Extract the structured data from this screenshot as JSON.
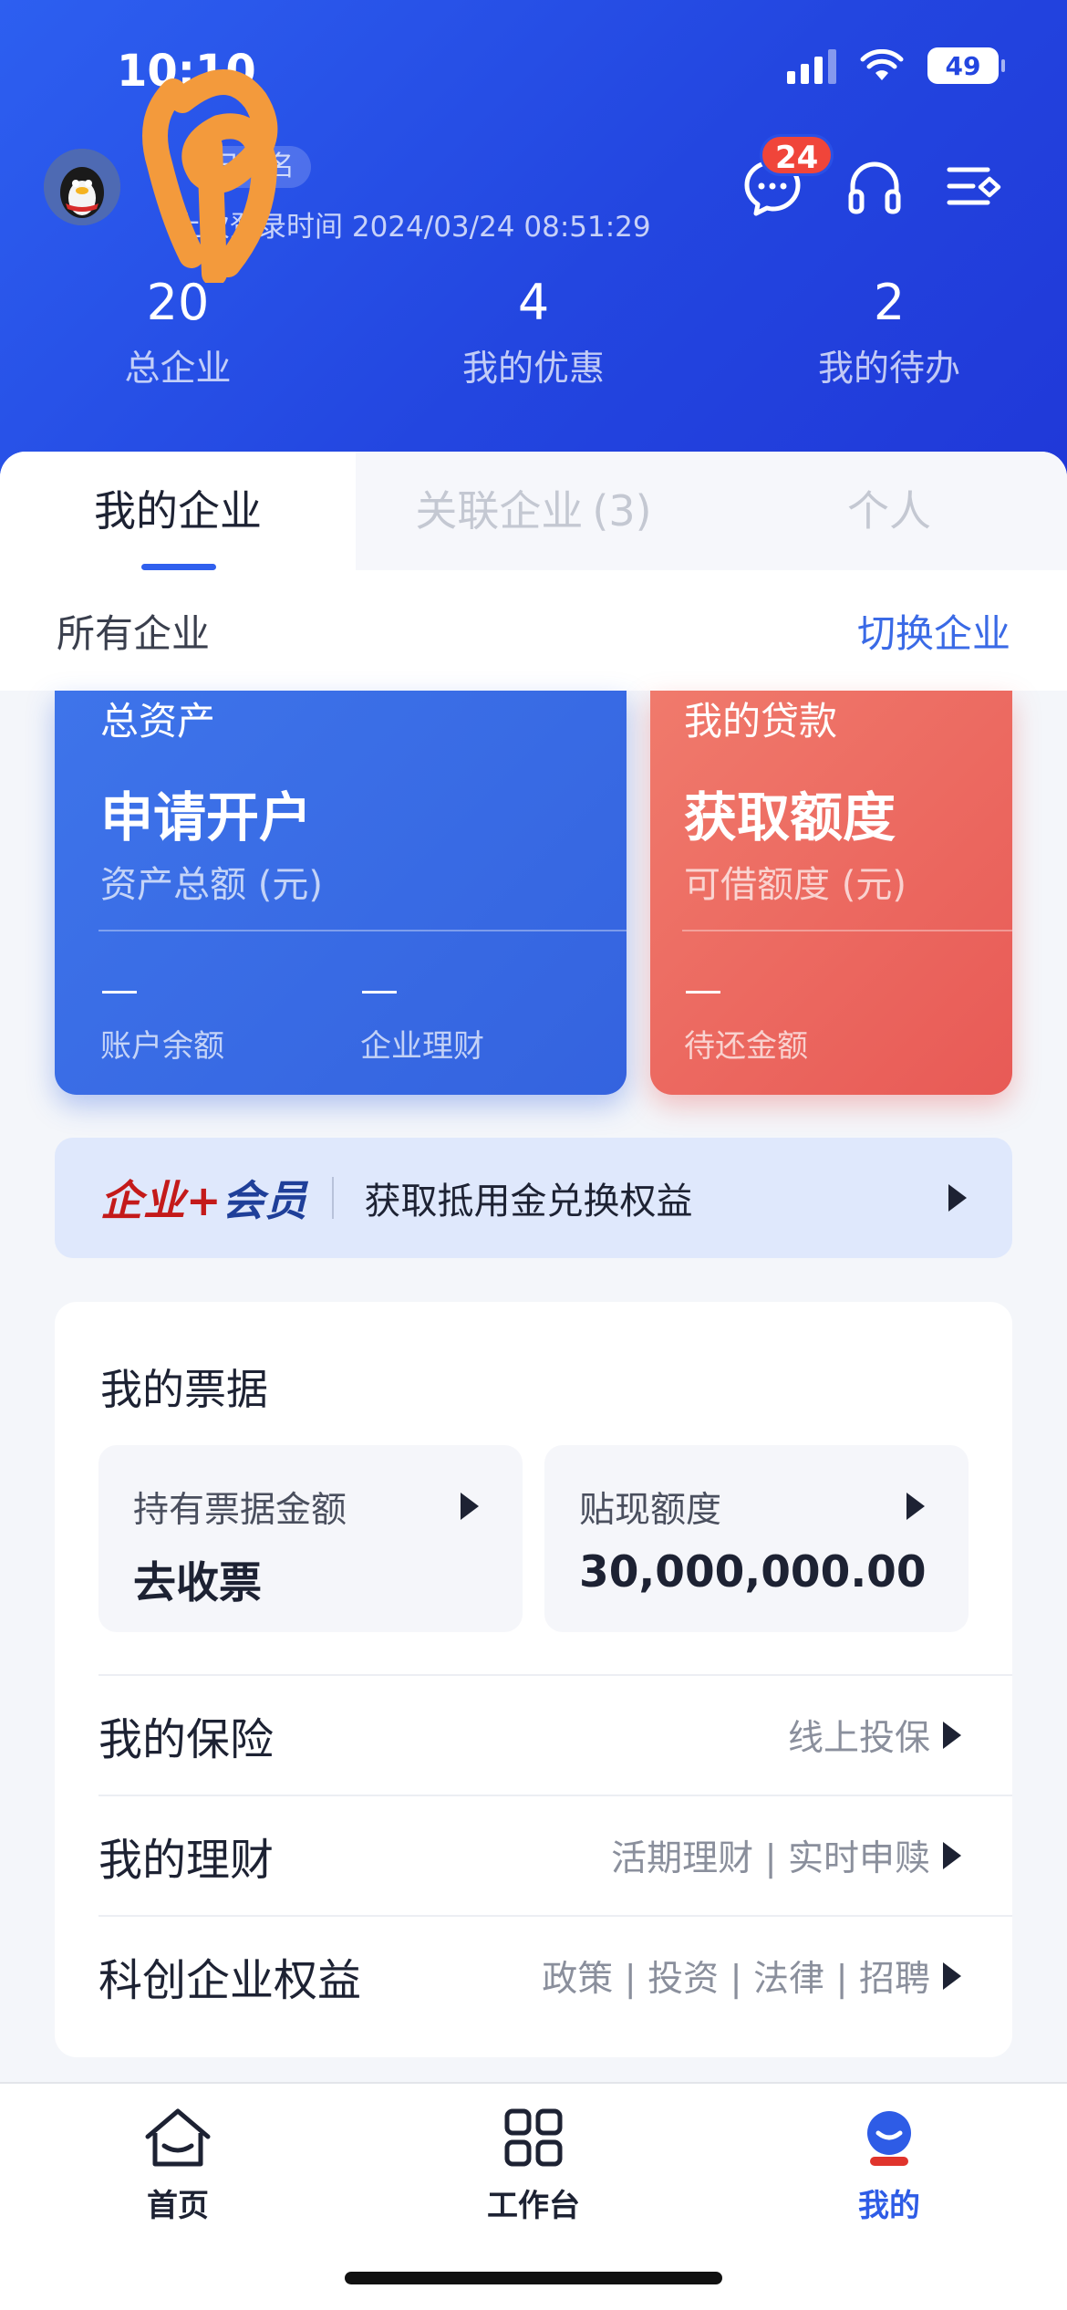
{
  "status_bar": {
    "time": "10:10",
    "battery": "49"
  },
  "header": {
    "verified_label": "已实名",
    "last_login": "上次登录时间 2024/03/24 08:51:29",
    "message_badge": "24",
    "stats": [
      {
        "value": "20",
        "label": "总企业"
      },
      {
        "value": "4",
        "label": "我的优惠"
      },
      {
        "value": "2",
        "label": "我的待办"
      }
    ]
  },
  "tabs": [
    {
      "label": "我的企业",
      "count": ""
    },
    {
      "label": "关联企业",
      "count": "(3)"
    },
    {
      "label": "个人",
      "count": ""
    }
  ],
  "subbar": {
    "left": "所有企业",
    "right": "切换企业"
  },
  "asset_card": {
    "title": "总资产",
    "big": "申请开户",
    "sub": "资产总额 (元)",
    "items": [
      {
        "value": "—",
        "label": "账户余额"
      },
      {
        "value": "—",
        "label": "企业理财"
      }
    ]
  },
  "loan_card": {
    "title": "我的贷款",
    "big": "获取额度",
    "sub": "可借额度 (元)",
    "items": [
      {
        "value": "—",
        "label": "待还金额"
      }
    ]
  },
  "banner": {
    "logo_red": "企业",
    "logo_plus": "+",
    "logo_blue": "会员",
    "text": "获取抵用金兑换权益"
  },
  "bills": {
    "title": "我的票据",
    "boxes": [
      {
        "label": "持有票据金额",
        "value": "去收票"
      },
      {
        "label": "贴现额度",
        "value": "30,000,000.00"
      }
    ],
    "rows": [
      {
        "label": "我的保险",
        "right": "线上投保"
      },
      {
        "label": "我的理财",
        "right": "活期理财 | 实时申赎"
      },
      {
        "label": "科创企业权益",
        "right": "政策 | 投资 | 法律 | 招聘"
      }
    ]
  },
  "tabbar": [
    {
      "label": "首页"
    },
    {
      "label": "工作台"
    },
    {
      "label": "我的"
    }
  ],
  "colors": {
    "primary": "#2346e0",
    "accent_blue": "#3a6ae6",
    "loan_red": "#e85a56",
    "badge_red": "#f0453a"
  }
}
